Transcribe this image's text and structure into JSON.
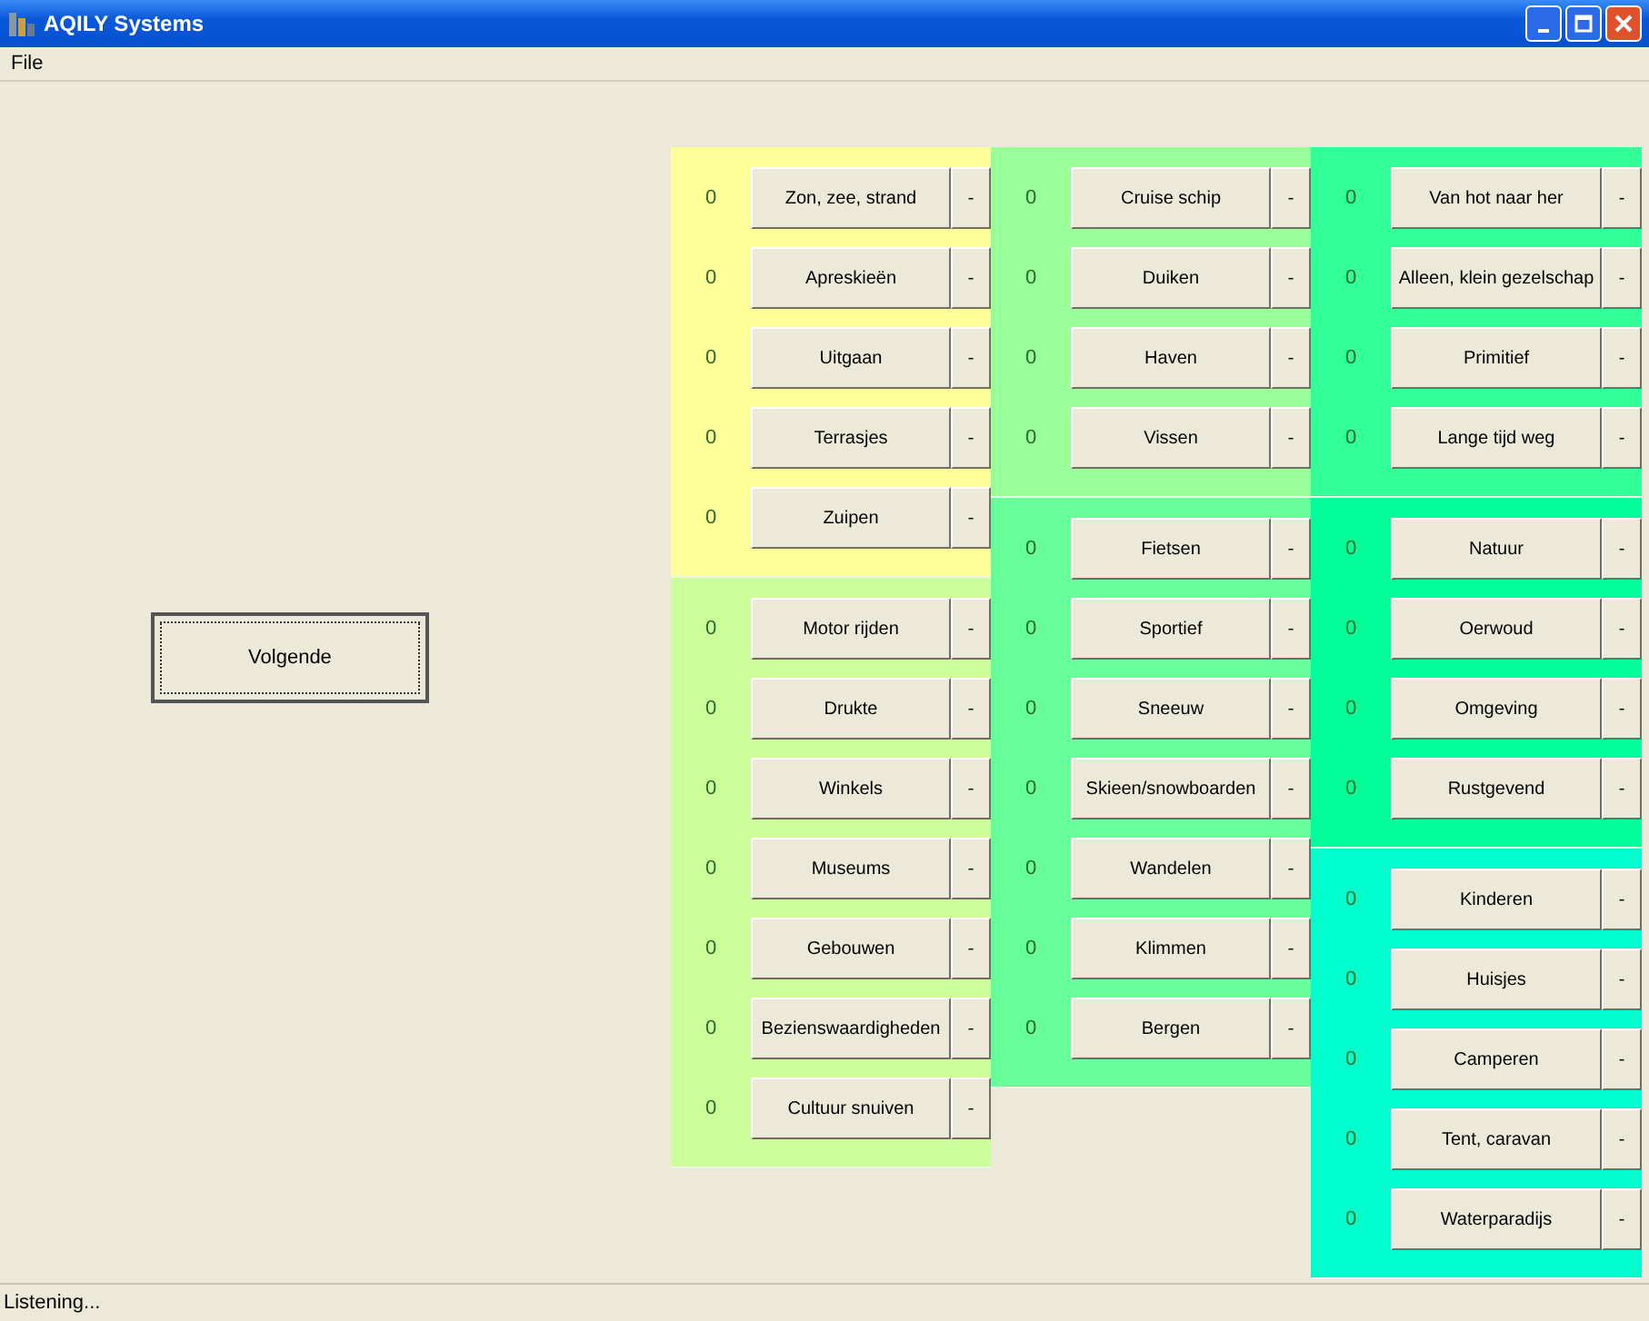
{
  "window": {
    "title": "AQILY Systems"
  },
  "menu": [
    "File"
  ],
  "next_button": "Volgende",
  "columns": [
    {
      "groups": [
        {
          "color": "#ffff99",
          "rows": [
            {
              "count": "0",
              "label": "Zon, zee, strand",
              "minus": "-"
            },
            {
              "count": "0",
              "label": "Apreskieën",
              "minus": "-"
            },
            {
              "count": "0",
              "label": "Uitgaan",
              "minus": "-"
            },
            {
              "count": "0",
              "label": "Terrasjes",
              "minus": "-"
            },
            {
              "count": "0",
              "label": "Zuipen",
              "minus": "-"
            }
          ]
        },
        {
          "color": "#ccff99",
          "rows": [
            {
              "count": "0",
              "label": "Motor rijden",
              "minus": "-"
            },
            {
              "count": "0",
              "label": "Drukte",
              "minus": "-"
            },
            {
              "count": "0",
              "label": "Winkels",
              "minus": "-"
            },
            {
              "count": "0",
              "label": "Museums",
              "minus": "-"
            },
            {
              "count": "0",
              "label": "Gebouwen",
              "minus": "-"
            },
            {
              "count": "0",
              "label": "Bezienswaardigheden",
              "minus": "-"
            },
            {
              "count": "0",
              "label": "Cultuur snuiven",
              "minus": "-"
            }
          ]
        }
      ]
    },
    {
      "groups": [
        {
          "color": "#99ff99",
          "rows": [
            {
              "count": "0",
              "label": "Cruise schip",
              "minus": "-"
            },
            {
              "count": "0",
              "label": "Duiken",
              "minus": "-"
            },
            {
              "count": "0",
              "label": "Haven",
              "minus": "-"
            },
            {
              "count": "0",
              "label": "Vissen",
              "minus": "-"
            }
          ]
        },
        {
          "color": "#66ff99",
          "rows": [
            {
              "count": "0",
              "label": "Fietsen",
              "minus": "-"
            },
            {
              "count": "0",
              "label": "Sportief",
              "minus": "-"
            },
            {
              "count": "0",
              "label": "Sneeuw",
              "minus": "-"
            },
            {
              "count": "0",
              "label": "Skieen/snowboarden",
              "minus": "-"
            },
            {
              "count": "0",
              "label": "Wandelen",
              "minus": "-"
            },
            {
              "count": "0",
              "label": "Klimmen",
              "minus": "-"
            },
            {
              "count": "0",
              "label": "Bergen",
              "minus": "-"
            }
          ]
        }
      ]
    },
    {
      "groups": [
        {
          "color": "#33ff99",
          "rows": [
            {
              "count": "0",
              "label": "Van hot naar her",
              "minus": "-"
            },
            {
              "count": "0",
              "label": "Alleen, klein gezelschap",
              "minus": "-"
            },
            {
              "count": "0",
              "label": "Primitief",
              "minus": "-"
            },
            {
              "count": "0",
              "label": "Lange tijd weg",
              "minus": "-"
            }
          ]
        },
        {
          "color": "#00ff99",
          "rows": [
            {
              "count": "0",
              "label": "Natuur",
              "minus": "-"
            },
            {
              "count": "0",
              "label": "Oerwoud",
              "minus": "-"
            },
            {
              "count": "0",
              "label": "Omgeving",
              "minus": "-"
            },
            {
              "count": "0",
              "label": "Rustgevend",
              "minus": "-"
            }
          ]
        },
        {
          "color": "#00ffcc",
          "rows": [
            {
              "count": "0",
              "label": "Kinderen",
              "minus": "-"
            },
            {
              "count": "0",
              "label": "Huisjes",
              "minus": "-"
            },
            {
              "count": "0",
              "label": "Camperen",
              "minus": "-"
            },
            {
              "count": "0",
              "label": "Tent, caravan",
              "minus": "-"
            },
            {
              "count": "0",
              "label": "Waterparadijs",
              "minus": "-"
            }
          ]
        }
      ]
    }
  ],
  "status_bar": "Listening..."
}
